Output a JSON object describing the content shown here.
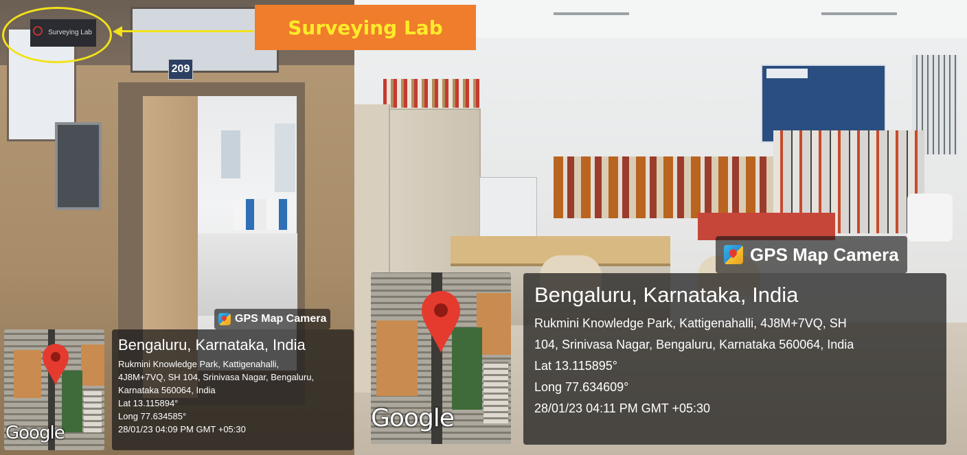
{
  "callout": {
    "label": "Surveying Lab"
  },
  "left_photo": {
    "room_number": "209",
    "door_sign": "Surveying Lab",
    "gps": {
      "brand": "GPS Map Camera",
      "title": "Bengaluru, Karnataka, India",
      "address_lines": [
        "Rukmini Knowledge Park, Kattigenahalli,",
        "4J8M+7VQ, SH 104, Srinivasa Nagar, Bengaluru,",
        "Karnataka 560064, India"
      ],
      "lat": "Lat 13.115894°",
      "long": "Long 77.634585°",
      "datetime": "28/01/23 04:09 PM GMT +05:30",
      "map_logo": "Google"
    }
  },
  "right_photo": {
    "gps": {
      "brand": "GPS Map Camera",
      "title": "Bengaluru, Karnataka, India",
      "address_lines": [
        "Rukmini Knowledge Park, Kattigenahalli, 4J8M+7VQ, SH",
        "104, Srinivasa Nagar, Bengaluru, Karnataka 560064, India"
      ],
      "lat": "Lat 13.115895°",
      "long": "Long 77.634609°",
      "datetime": "28/01/23 04:11 PM GMT +05:30",
      "map_logo": "Google"
    }
  },
  "colors": {
    "callout_bg": "#ef7d2b",
    "callout_text": "#ffeb2a",
    "highlight": "#f1e21a",
    "pin": "#e53b2f"
  }
}
